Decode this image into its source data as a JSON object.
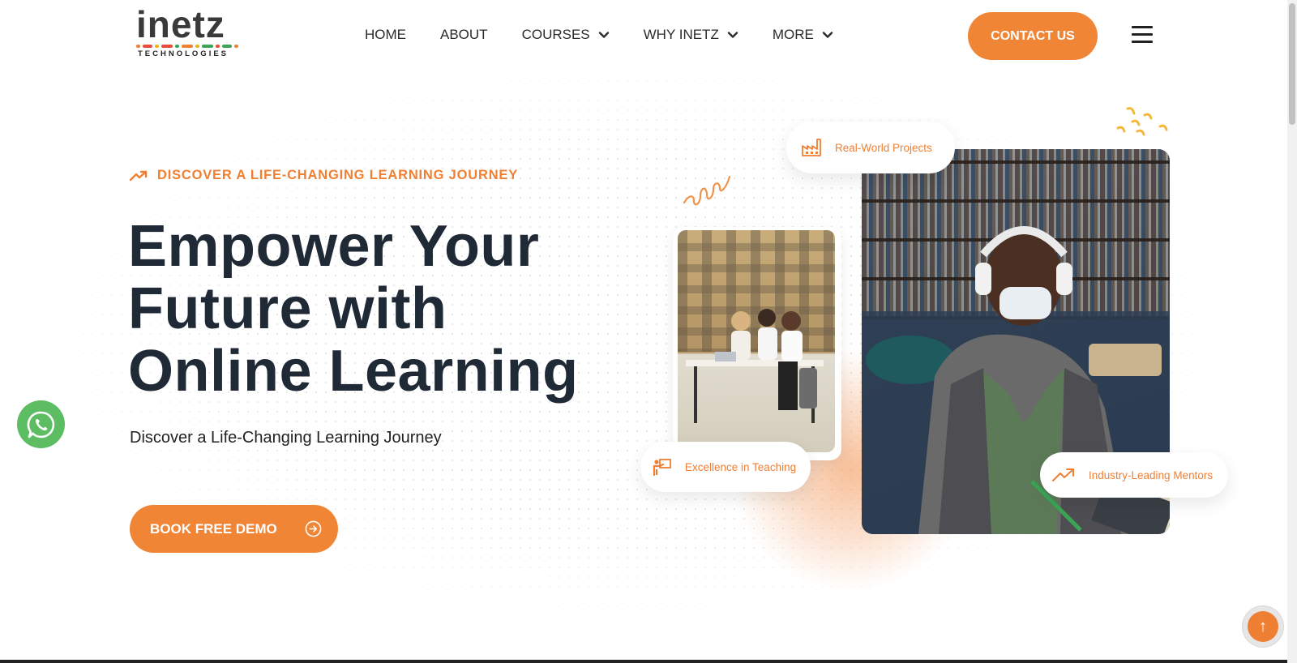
{
  "header": {
    "logo": {
      "word": "inetz",
      "subtitle": "TECHNOLOGIES"
    },
    "nav": [
      {
        "label": "HOME",
        "dropdown": false
      },
      {
        "label": "ABOUT",
        "dropdown": false
      },
      {
        "label": "COURSES",
        "dropdown": true
      },
      {
        "label": "WHY INETZ",
        "dropdown": true
      },
      {
        "label": "MORE",
        "dropdown": true
      }
    ],
    "contact_label": "CONTACT US",
    "menu_icon": "hamburger-menu-icon"
  },
  "hero": {
    "eyebrow": "DISCOVER A LIFE-CHANGING LEARNING JOURNEY",
    "title_lines": [
      "Empower Your",
      "Future with",
      "Online Learning"
    ],
    "subtitle": "Discover a Life-Changing Learning Journey",
    "cta_label": "BOOK FREE DEMO"
  },
  "badges": {
    "projects": "Real-World Projects",
    "teaching": "Excellence in Teaching",
    "mentors": "Industry-Leading Mentors"
  },
  "floating": {
    "whatsapp_icon": "whatsapp-icon",
    "scroll_top_icon": "arrow-up-icon"
  },
  "colors": {
    "accent": "#f08536",
    "text_dark": "#202a36",
    "whatsapp": "#5cbd63"
  }
}
